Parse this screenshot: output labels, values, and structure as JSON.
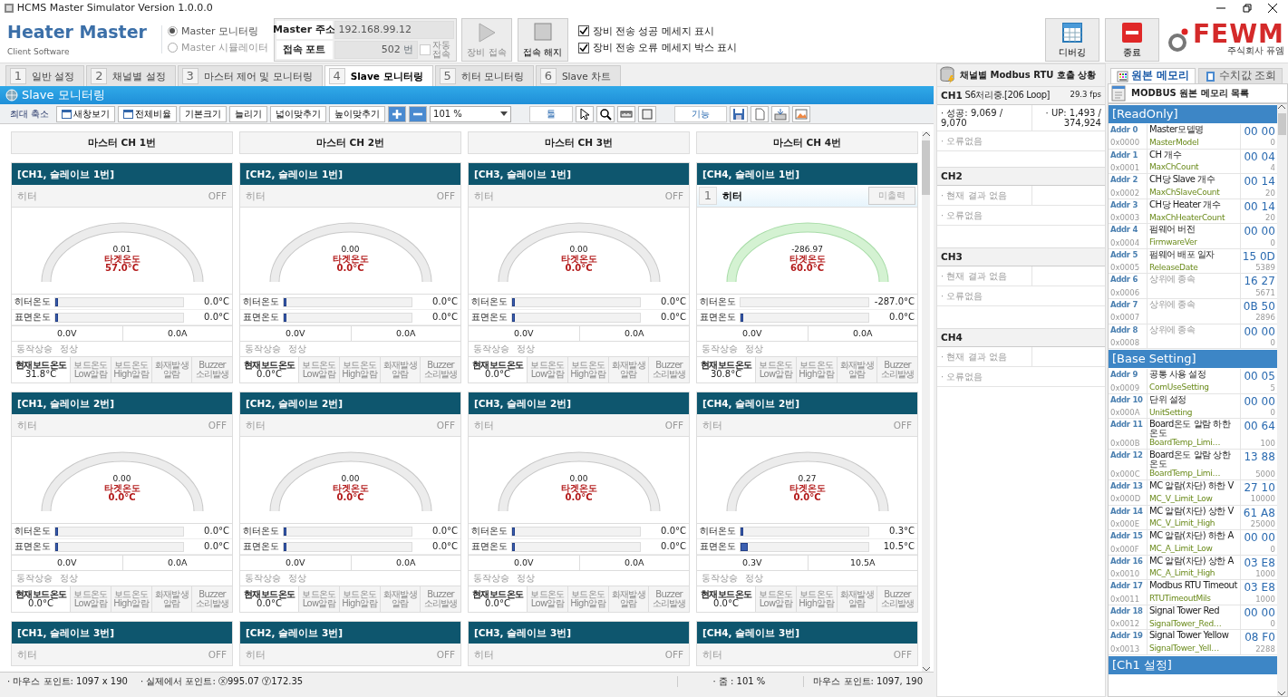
{
  "window": {
    "title": "HCMS Master Simulator Version 1.0.0.0"
  },
  "header": {
    "app_name": "Heater Master",
    "subtitle": "Client Software",
    "modes": [
      {
        "label": "Master 모니터링",
        "selected": true
      },
      {
        "label": "Master 시뮬레이터",
        "selected": false
      }
    ],
    "address": {
      "label": "Master 주소",
      "value": "192.168.99.12"
    },
    "port": {
      "label": "접속 포트",
      "value": "502",
      "unit": "번"
    },
    "auto_connect": {
      "label": "자동 접속",
      "checked": false
    },
    "connect_button": {
      "label": "장비 접속",
      "disabled": true
    },
    "disconnect_button": {
      "label": "접속 해지",
      "disabled": false
    },
    "options": [
      {
        "label": "장비 전송 성공 메세지 표시",
        "checked": true
      },
      {
        "label": "장비 전송 오류 메세지 박스 표시",
        "checked": true
      }
    ],
    "debug_button": "디버깅",
    "exit_button": "종료",
    "logo": {
      "name": "FEWM",
      "company": "주식회사 퓨엠"
    }
  },
  "tabs": [
    {
      "number": "1",
      "label": "일반 설정",
      "selected": false
    },
    {
      "number": "2",
      "label": "채널별 설정",
      "selected": false
    },
    {
      "number": "3",
      "label": "마스터 제어 및 모니터링",
      "selected": false
    },
    {
      "number": "4",
      "label": "Slave 모니터링",
      "selected": true
    },
    {
      "number": "5",
      "label": "히터 모니터링",
      "selected": false
    },
    {
      "number": "6",
      "label": "Slave 차트",
      "selected": false
    }
  ],
  "monitor": {
    "title": "Slave 모니터링",
    "toolbar": {
      "buttons": [
        {
          "label": "최대 축소",
          "kind": "plain"
        },
        {
          "label": "새창보기",
          "kind": "icon"
        },
        {
          "label": "전체비율",
          "kind": "icon"
        },
        {
          "label": "기본크기",
          "kind": "plain"
        },
        {
          "label": "늘리기",
          "kind": "plain"
        },
        {
          "label": "넓이맞추기",
          "kind": "plain"
        },
        {
          "label": "높이맞추기",
          "kind": "plain"
        }
      ],
      "zoom": "101 %",
      "tool_label": "툴",
      "function_label": "기능"
    },
    "columns": [
      "마스터 CH 1번",
      "마스터 CH 2번",
      "마스터 CH 3번",
      "마스터 CH 4번"
    ],
    "cards": [
      {
        "title": "[CH1, 슬레이브 1번]",
        "heater": {
          "kind": "switch",
          "label": "히터",
          "state": "OFF"
        },
        "gauge": {
          "value": "0.01",
          "target_label": "타겟온도",
          "target": "57.0°C",
          "active": false
        },
        "heater_temp": {
          "label": "히터온도",
          "level": 0.02,
          "reading": "0.0°C"
        },
        "surface_temp": {
          "label": "표면온도",
          "level": 0.02,
          "reading": "0.0°C"
        },
        "voltage": "0.0V",
        "current": "0.0A",
        "status": {
          "label": "동작상승",
          "value": "정상"
        },
        "board": {
          "label": "현재보드온도",
          "value": "31.8°C"
        },
        "alarms": [
          {
            "lines": [
              "보드온도",
              "Low알람"
            ],
            "active": false
          },
          {
            "lines": [
              "보드온도",
              "High알람"
            ],
            "active": false
          },
          {
            "lines": [
              "화재발생",
              "알람"
            ],
            "active": false
          },
          {
            "lines": [
              "Buzzer",
              "소리발생"
            ],
            "active": false
          }
        ]
      },
      {
        "title": "[CH2, 슬레이브 1번]",
        "heater": {
          "kind": "switch",
          "label": "히터",
          "state": "OFF"
        },
        "gauge": {
          "value": "0.00",
          "target_label": "타겟온도",
          "target": "0.0°C",
          "active": false
        },
        "heater_temp": {
          "label": "히터온도",
          "level": 0.02,
          "reading": "0.0°C"
        },
        "surface_temp": {
          "label": "표면온도",
          "level": 0.02,
          "reading": "0.0°C"
        },
        "voltage": "0.0V",
        "current": "0.0A",
        "status": {
          "label": "동작상승",
          "value": "정상"
        },
        "board": {
          "label": "현재보드온도",
          "value": "0.0°C"
        },
        "alarms": [
          {
            "lines": [
              "보드온도",
              "Low알람"
            ],
            "active": false
          },
          {
            "lines": [
              "보드온도",
              "High알람"
            ],
            "active": false
          },
          {
            "lines": [
              "화재발생",
              "알람"
            ],
            "active": false
          },
          {
            "lines": [
              "Buzzer",
              "소리발생"
            ],
            "active": false
          }
        ]
      },
      {
        "title": "[CH3, 슬레이브 1번]",
        "heater": {
          "kind": "switch",
          "label": "히터",
          "state": "OFF"
        },
        "gauge": {
          "value": "0.00",
          "target_label": "타겟온도",
          "target": "0.0°C",
          "active": false
        },
        "heater_temp": {
          "label": "히터온도",
          "level": 0.02,
          "reading": "0.0°C"
        },
        "surface_temp": {
          "label": "표면온도",
          "level": 0.02,
          "reading": "0.0°C"
        },
        "voltage": "0.0V",
        "current": "0.0A",
        "status": {
          "label": "동작상승",
          "value": "정상"
        },
        "board": {
          "label": "현재보드온도",
          "value": "0.0°C"
        },
        "alarms": [
          {
            "lines": [
              "보드온도",
              "Low알람"
            ],
            "active": false
          },
          {
            "lines": [
              "보드온도",
              "High알람"
            ],
            "active": false
          },
          {
            "lines": [
              "화재발생",
              "알람"
            ],
            "active": false
          },
          {
            "lines": [
              "Buzzer",
              "소리발생"
            ],
            "active": false
          }
        ]
      },
      {
        "title": "[CH4, 슬레이브 1번]",
        "heater": {
          "kind": "numbered",
          "number": "1",
          "label": "히터",
          "state": "미출력"
        },
        "gauge": {
          "value": "-286.97",
          "target_label": "타겟온도",
          "target": "60.0°C",
          "active": true
        },
        "heater_temp": {
          "label": "히터온도",
          "level": 0,
          "reading": "-287.0°C"
        },
        "surface_temp": {
          "label": "표면온도",
          "level": 0.02,
          "reading": "0.0°C"
        },
        "voltage": "0.0V",
        "current": "0.0A",
        "status": {
          "label": "동작상승",
          "value": "정상"
        },
        "board": {
          "label": "현재보드온도",
          "value": "30.8°C"
        },
        "alarms": [
          {
            "lines": [
              "보드온도",
              "Low알람"
            ],
            "active": false
          },
          {
            "lines": [
              "보드온도",
              "High알람"
            ],
            "active": false
          },
          {
            "lines": [
              "화재발생",
              "알람"
            ],
            "active": false
          },
          {
            "lines": [
              "Buzzer",
              "소리발생"
            ],
            "active": false
          }
        ]
      },
      {
        "title": "[CH1, 슬레이브 2번]",
        "heater": {
          "kind": "switch",
          "label": "히터",
          "state": "OFF"
        },
        "gauge": {
          "value": "0.00",
          "target_label": "타겟온도",
          "target": "0.0°C",
          "active": false
        },
        "heater_temp": {
          "label": "히터온도",
          "level": 0.02,
          "reading": "0.0°C"
        },
        "surface_temp": {
          "label": "표면온도",
          "level": 0.02,
          "reading": "0.0°C"
        },
        "voltage": "0.0V",
        "current": "0.0A",
        "status": {
          "label": "동작상승",
          "value": "정상"
        },
        "board": {
          "label": "현재보드온도",
          "value": "0.0°C"
        },
        "alarms": [
          {
            "lines": [
              "보드온도",
              "Low알람"
            ],
            "active": false
          },
          {
            "lines": [
              "보드온도",
              "High알람"
            ],
            "active": false
          },
          {
            "lines": [
              "화재발생",
              "알람"
            ],
            "active": false
          },
          {
            "lines": [
              "Buzzer",
              "소리발생"
            ],
            "active": false
          }
        ]
      },
      {
        "title": "[CH2, 슬레이브 2번]",
        "heater": {
          "kind": "switch",
          "label": "히터",
          "state": "OFF"
        },
        "gauge": {
          "value": "0.00",
          "target_label": "타겟온도",
          "target": "0.0°C",
          "active": false
        },
        "heater_temp": {
          "label": "히터온도",
          "level": 0.02,
          "reading": "0.0°C"
        },
        "surface_temp": {
          "label": "표면온도",
          "level": 0.02,
          "reading": "0.0°C"
        },
        "voltage": "0.0V",
        "current": "0.0A",
        "status": {
          "label": "동작상승",
          "value": "정상"
        },
        "board": {
          "label": "현재보드온도",
          "value": "0.0°C"
        },
        "alarms": [
          {
            "lines": [
              "보드온도",
              "Low알람"
            ],
            "active": false
          },
          {
            "lines": [
              "보드온도",
              "High알람"
            ],
            "active": false
          },
          {
            "lines": [
              "화재발생",
              "알람"
            ],
            "active": false
          },
          {
            "lines": [
              "Buzzer",
              "소리발생"
            ],
            "active": false
          }
        ]
      },
      {
        "title": "[CH3, 슬레이브 2번]",
        "heater": {
          "kind": "switch",
          "label": "히터",
          "state": "OFF"
        },
        "gauge": {
          "value": "0.00",
          "target_label": "타겟온도",
          "target": "0.0°C",
          "active": false
        },
        "heater_temp": {
          "label": "히터온도",
          "level": 0.02,
          "reading": "0.0°C"
        },
        "surface_temp": {
          "label": "표면온도",
          "level": 0.02,
          "reading": "0.0°C"
        },
        "voltage": "0.0V",
        "current": "0.0A",
        "status": {
          "label": "동작상승",
          "value": "정상"
        },
        "board": {
          "label": "현재보드온도",
          "value": "0.0°C"
        },
        "alarms": [
          {
            "lines": [
              "보드온도",
              "Low알람"
            ],
            "active": false
          },
          {
            "lines": [
              "보드온도",
              "High알람"
            ],
            "active": false
          },
          {
            "lines": [
              "화재발생",
              "알람"
            ],
            "active": false
          },
          {
            "lines": [
              "Buzzer",
              "소리발생"
            ],
            "active": false
          }
        ]
      },
      {
        "title": "[CH4, 슬레이브 2번]",
        "heater": {
          "kind": "switch",
          "label": "히터",
          "state": "OFF"
        },
        "gauge": {
          "value": "0.27",
          "target_label": "타겟온도",
          "target": "0.0°C",
          "active": false
        },
        "heater_temp": {
          "label": "히터온도",
          "level": 0.02,
          "reading": "0.3°C"
        },
        "surface_temp": {
          "label": "표면온도",
          "level": 0.06,
          "reading": "10.5°C"
        },
        "voltage": "0.3V",
        "current": "10.5A",
        "status": {
          "label": "동작상승",
          "value": "정상"
        },
        "board": {
          "label": "현재보드온도",
          "value": "0.0°C"
        },
        "alarms": [
          {
            "lines": [
              "보드온도",
              "Low알람"
            ],
            "active": false
          },
          {
            "lines": [
              "보드온도",
              "High알람"
            ],
            "active": false
          },
          {
            "lines": [
              "화재발생",
              "알람"
            ],
            "active": false
          },
          {
            "lines": [
              "Buzzer",
              "소리발생"
            ],
            "active": false
          }
        ]
      },
      {
        "title": "[CH1, 슬레이브 3번]",
        "heater": {
          "kind": "switch",
          "label": "히터",
          "state": "OFF"
        }
      },
      {
        "title": "[CH2, 슬레이브 3번]",
        "heater": {
          "kind": "switch",
          "label": "히터",
          "state": "OFF"
        }
      },
      {
        "title": "[CH3, 슬레이브 3번]",
        "heater": {
          "kind": "switch",
          "label": "히터",
          "state": "OFF"
        }
      },
      {
        "title": "[CH4, 슬레이브 3번]",
        "heater": {
          "kind": "switch",
          "label": "히터",
          "state": "OFF"
        }
      }
    ]
  },
  "status_bar": {
    "mouse": "· 마우스 포인트: 1097 x 190",
    "real": "· 실제에서 포인트: ⓧ995.07 ⓨ172.35",
    "zoom": "· 줌 : 101 %",
    "mouse_right": "마우스 포인트: 1097, 190"
  },
  "channels": {
    "title": "채널별 Modbus RTU 호출 상황",
    "items": [
      {
        "name": "CH1",
        "status": "S6처리중.[206 Loop]",
        "fps": "29.3 fps",
        "rows": [
          {
            "cells": [
              "· 성공: 9,069 / 9,070",
              "· UP: 1,493 / 374,924"
            ],
            "muted": false
          },
          {
            "cells": [
              "· 오류없음"
            ],
            "muted": true
          }
        ]
      },
      {
        "name": "CH2",
        "rows": [
          {
            "cells": [
              "· 현재 결과 없음"
            ],
            "split": true,
            "muted": true
          },
          {
            "cells": [
              "· 오류없음"
            ],
            "muted": true
          }
        ]
      },
      {
        "name": "CH3",
        "rows": [
          {
            "cells": [
              "· 현재 결과 없음"
            ],
            "split": true,
            "muted": true
          },
          {
            "cells": [
              "· 오류없음"
            ],
            "muted": true
          }
        ]
      },
      {
        "name": "CH4",
        "rows": [
          {
            "cells": [
              "· 현재 결과 없음"
            ],
            "split": true,
            "muted": true
          },
          {
            "cells": [
              "· 오류없음"
            ],
            "muted": true
          }
        ]
      }
    ]
  },
  "memory": {
    "tabs": [
      {
        "label": "원본 메모리",
        "selected": true
      },
      {
        "label": "수치값 조회",
        "selected": false
      }
    ],
    "title": "MODBUS 원본 메모리 목록",
    "sections": [
      {
        "title": "[ReadOnly]",
        "rows": [
          {
            "addr": "Addr 0",
            "hex": "0x0000",
            "name": "Master모델명",
            "key": "MasterModel",
            "value": "00 00",
            "decimal": "0",
            "dependent": false
          },
          {
            "addr": "Addr 1",
            "hex": "0x0001",
            "name": "CH 개수",
            "key": "MaxChCount",
            "value": "00 04",
            "decimal": "4",
            "dependent": false
          },
          {
            "addr": "Addr 2",
            "hex": "0x0002",
            "name": "CH당 Slave 개수",
            "key": "MaxChSlaveCount",
            "value": "00 14",
            "decimal": "20",
            "dependent": false
          },
          {
            "addr": "Addr 3",
            "hex": "0x0003",
            "name": "CH당 Heater 개수",
            "key": "MaxChHeaterCount",
            "value": "00 14",
            "decimal": "20",
            "dependent": false
          },
          {
            "addr": "Addr 4",
            "hex": "0x0004",
            "name": "펌웨어 버전",
            "key": "FirmwareVer",
            "value": "00 00",
            "decimal": "0",
            "dependent": false
          },
          {
            "addr": "Addr 5",
            "hex": "0x0005",
            "name": "펌웨어 배포 일자",
            "key": "ReleaseDate",
            "value": "15 0D",
            "decimal": "5389",
            "dependent": false
          },
          {
            "addr": "Addr 6",
            "hex": "0x0006",
            "name": "상위에 종속",
            "value": "16 27",
            "decimal": "5671",
            "dependent": true
          },
          {
            "addr": "Addr 7",
            "hex": "0x0007",
            "name": "상위에 종속",
            "value": "0B 50",
            "decimal": "2896",
            "dependent": true
          },
          {
            "addr": "Addr 8",
            "hex": "0x0008",
            "name": "상위에 종속",
            "value": "00 00",
            "decimal": "0",
            "dependent": true
          }
        ]
      },
      {
        "title": "[Base Setting]",
        "rows": [
          {
            "addr": "Addr 9",
            "hex": "0x0009",
            "name": "공통 사용 설정",
            "key": "ComUseSetting",
            "value": "00 05",
            "decimal": "5",
            "dependent": false
          },
          {
            "addr": "Addr 10",
            "hex": "0x000A",
            "name": "단위 설정",
            "key": "UnitSetting",
            "value": "00 00",
            "decimal": "0",
            "dependent": false
          },
          {
            "addr": "Addr 11",
            "hex": "0x000B",
            "name": "Board온도 알람 하한 온도",
            "key": "BoardTemp_Limi…",
            "value": "00 64",
            "decimal": "100",
            "dependent": false
          },
          {
            "addr": "Addr 12",
            "hex": "0x000C",
            "name": "Board온도 알람 상한 온도",
            "key": "BoardTemp_Limi…",
            "value": "13 88",
            "decimal": "5000",
            "dependent": false
          },
          {
            "addr": "Addr 13",
            "hex": "0x000D",
            "name": "MC 알람(차단) 하한 V",
            "key": "MC_V_Limit_Low",
            "value": "27 10",
            "decimal": "10000",
            "dependent": false
          },
          {
            "addr": "Addr 14",
            "hex": "0x000E",
            "name": "MC 알람(차단) 상한 V",
            "key": "MC_V_Limit_High",
            "value": "61 A8",
            "decimal": "25000",
            "dependent": false
          },
          {
            "addr": "Addr 15",
            "hex": "0x000F",
            "name": "MC 알람(차단) 하한 A",
            "key": "MC_A_Limit_Low",
            "value": "00 00",
            "decimal": "0",
            "dependent": false
          },
          {
            "addr": "Addr 16",
            "hex": "0x0010",
            "name": "MC 알람(차단) 상한 A",
            "key": "MC_A_Limit_High",
            "value": "03 E8",
            "decimal": "1000",
            "dependent": false
          },
          {
            "addr": "Addr 17",
            "hex": "0x0011",
            "name": "Modbus RTU Timeout",
            "key": "RTUTimeoutMils",
            "value": "03 E8",
            "decimal": "1000",
            "dependent": false
          },
          {
            "addr": "Addr 18",
            "hex": "0x0012",
            "name": "Signal Tower Red",
            "key": "SignalTower_Red…",
            "value": "00 00",
            "decimal": "0",
            "dependent": false
          },
          {
            "addr": "Addr 19",
            "hex": "0x0013",
            "name": "Signal Tower Yellow",
            "key": "SignalTower_Yell…",
            "value": "08 F0",
            "decimal": "2288",
            "dependent": false
          }
        ]
      },
      {
        "title": "[Ch1 설정]"
      }
    ]
  }
}
